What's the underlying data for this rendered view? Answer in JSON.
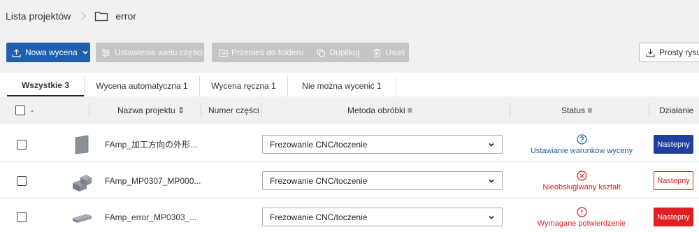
{
  "breadcrumb": {
    "root": "Lista projektów",
    "current": "error"
  },
  "toolbar": {
    "new_quote": "Nowa wycena",
    "multi_settings": "Ustawienia wielu części",
    "move_to_folder": "Przenieś do folderu",
    "duplicate": "Duplikuj",
    "delete": "Usuń",
    "simple_upload": "Prosty rysu"
  },
  "tabs": [
    {
      "label": "Wszystkie 3"
    },
    {
      "label": "Wycena automatyczna 1"
    },
    {
      "label": "Wycena ręczna 1"
    },
    {
      "label": "Nie można wycenić 1"
    }
  ],
  "table": {
    "headers": {
      "select": "-",
      "project_name": "Nazwa projektu ⇕",
      "part_number": "Numer części",
      "method": "Metoda obróbki ≡",
      "status": "Status ≡",
      "action": "Działanie"
    },
    "rows": [
      {
        "name": "FAmp_加工方向の外形...",
        "part_number": "",
        "method": "Frezowanie CNC/toczenie",
        "status": "Ustawianie warunków wyceny",
        "status_icon": "question-circle",
        "action": "Nastepny"
      },
      {
        "name": "FAmp_MP0307_MP000...",
        "part_number": "",
        "method": "Frezowanie CNC/toczenie",
        "status": "Nieobsługiwany kształt",
        "status_icon": "x-circle",
        "action": "Nastepny"
      },
      {
        "name": "FAmp_error_MP0303_...",
        "part_number": "",
        "method": "Frezowanie CNC/toczenie",
        "status": "Wymagane potwierdzenie",
        "status_icon": "exclamation-circle",
        "action": "Nastepny"
      }
    ]
  },
  "colors": {
    "primary": "#1f5fb0",
    "action_blue": "#1f3f9a",
    "error_red": "#e02020",
    "disabled": "#c5c5c5",
    "toolbar_bg": "#f1f1f1"
  }
}
